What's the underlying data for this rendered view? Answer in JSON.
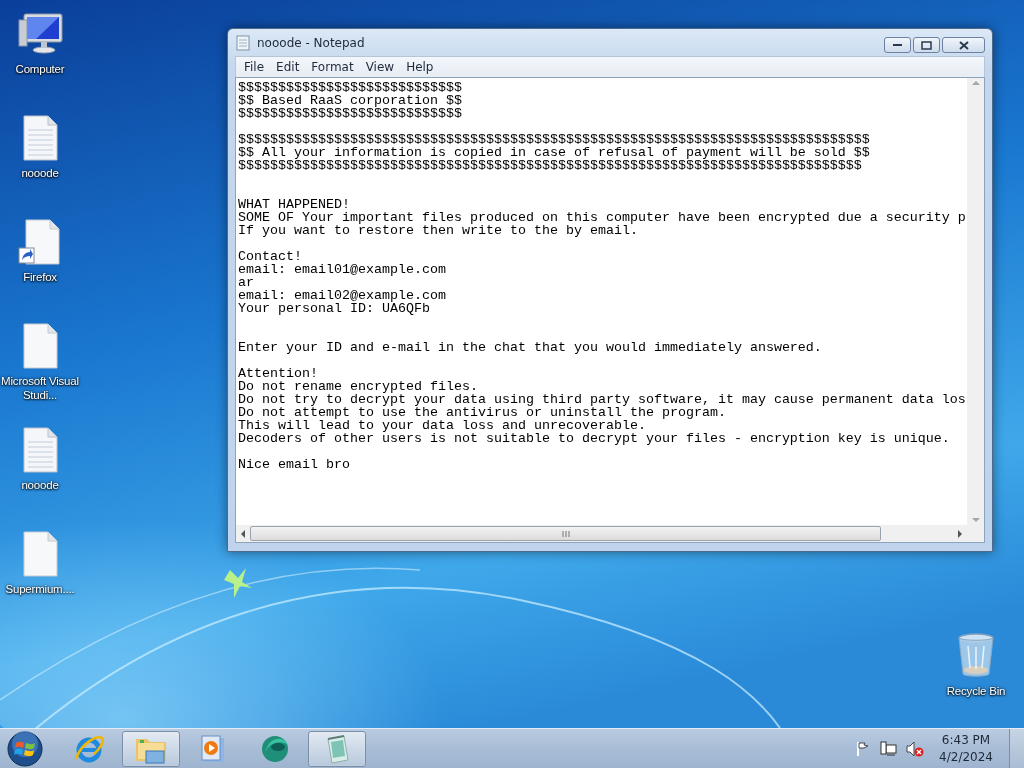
{
  "desktop_icons": [
    {
      "label": "Computer",
      "kind": "computer"
    },
    {
      "label": "nooode",
      "kind": "text-file"
    },
    {
      "label": "Firefox",
      "kind": "shortcut"
    },
    {
      "label": "Microsoft Visual Studi...",
      "kind": "blank-file"
    },
    {
      "label": "nooode",
      "kind": "text-file"
    },
    {
      "label": "Supermium....",
      "kind": "blank-file"
    }
  ],
  "recycle_bin": {
    "label": "Recycle Bin"
  },
  "window": {
    "title": "nooode - Notepad",
    "menu": [
      "File",
      "Edit",
      "Format",
      "View",
      "Help"
    ],
    "content": "$$$$$$$$$$$$$$$$$$$$$$$$$$$$\n$$ Based RaaS corporation $$\n$$$$$$$$$$$$$$$$$$$$$$$$$$$$\n\n$$$$$$$$$$$$$$$$$$$$$$$$$$$$$$$$$$$$$$$$$$$$$$$$$$$$$$$$$$$$$$$$$$$$$$$$$$$$$$$\n$$ All your information is copied in case of refusal of payment will be sold $$\n$$$$$$$$$$$$$$$$$$$$$$$$$$$$$$$$$$$$$$$$$$$$$$$$$$$$$$$$$$$$$$$$$$$$$$$$$$$$$$\n\n\nWHAT HAPPENED!\nSOME OF Your important files produced on this computer have been encrypted due a security p\nIf you want to restore then write to the by email.\n\nContact!\nemail: email01@example.com\nar\nemail: email02@example.com\nYour personal ID: UA6QFb\n\n\nEnter your ID and e-mail in the chat that you would immediately answered.\n\nAttention!\nDo not rename encrypted files.\nDo not try to decrypt your data using third party software, it may cause permanent data los\nDo not attempt to use the antivirus or uninstall the program.\nThis will lead to your data loss and unrecoverable.\nDecoders of other users is not suitable to decrypt your files - encryption key is unique.\n\nNice email bro"
  },
  "taskbar": {
    "items": [
      {
        "kind": "browser",
        "open": false
      },
      {
        "kind": "folder",
        "open": true
      },
      {
        "kind": "media",
        "open": false
      },
      {
        "kind": "sphere",
        "open": false
      },
      {
        "kind": "notepad",
        "open": true
      }
    ],
    "volume_muted": true,
    "clock": {
      "time": "6:43 PM",
      "date": "4/2/2024"
    }
  }
}
